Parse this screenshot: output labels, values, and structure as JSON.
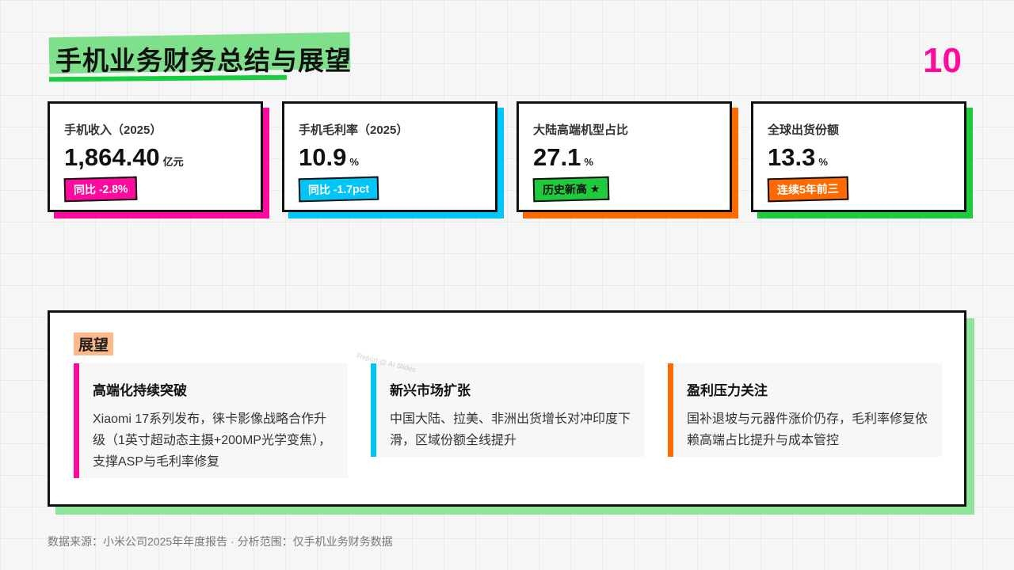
{
  "header": {
    "title": "手机业务财务总结与展望",
    "page_number": "10"
  },
  "kpis": [
    {
      "label": "手机收入（2025）",
      "value": "1,864.40",
      "unit": "亿元",
      "tag": "同比 -2.8%",
      "accent": "#ff0a9c",
      "tag_bg": "#ff0a9c",
      "tag_color": "#ffffff"
    },
    {
      "label": "手机毛利率（2025）",
      "value": "10.9",
      "unit": "%",
      "tag": "同比 -1.7pct",
      "accent": "#00c6f7",
      "tag_bg": "#00c6f7",
      "tag_color": "#ffffff"
    },
    {
      "label": "大陆高端机型占比",
      "value": "27.1",
      "unit": "%",
      "tag": "历史新高 ★",
      "accent": "#ff6a00",
      "tag_bg": "#1ecb3c",
      "tag_color": "#111111"
    },
    {
      "label": "全球出货份额",
      "value": "13.3",
      "unit": "%",
      "tag": "连续5年前三",
      "accent": "#1ecb3c",
      "tag_bg": "#ff6a00",
      "tag_color": "#ffffff"
    }
  ],
  "outlook": {
    "title": "展望",
    "items": [
      {
        "heading": "高端化持续突破",
        "text": "Xiaomi 17系列发布，徕卡影像战略合作升级（1英寸超动态主摄+200MP光学变焦），支撑ASP与毛利率修复",
        "accent": "#ff0a9c"
      },
      {
        "heading": "新兴市场扩张",
        "text": "中国大陆、拉美、非洲出货增长对冲印度下滑，区域份额全线提升",
        "accent": "#00c6f7"
      },
      {
        "heading": "盈利压力关注",
        "text": "国补退坡与元器件涨价仍存，毛利率修复依赖高端占比提升与成本管控",
        "accent": "#ff6a00"
      }
    ]
  },
  "watermark": "Report @ AI Slides",
  "footer": "数据来源：小米公司2025年年度报告 · 分析范围：仅手机业务财务数据"
}
